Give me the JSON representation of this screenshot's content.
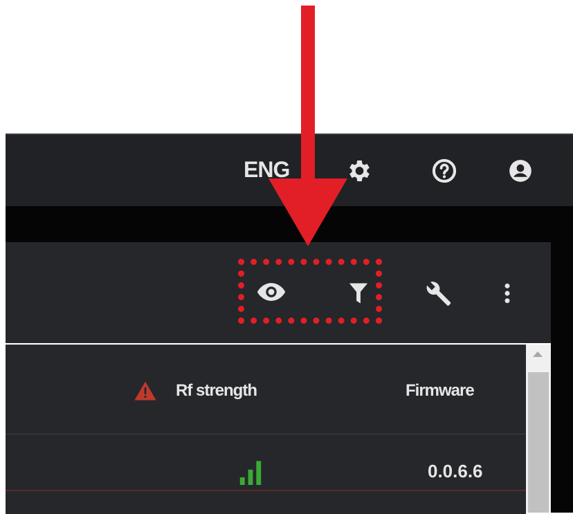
{
  "topbar": {
    "language": "ENG",
    "icons": [
      "gear-icon",
      "help-icon",
      "account-icon"
    ]
  },
  "toolbar": {
    "icons": [
      "eye-icon",
      "filter-icon",
      "wrench-icon",
      "more-vert-icon"
    ]
  },
  "table": {
    "headers": [
      "Rf strength",
      "Firmware"
    ],
    "rows": [
      {
        "rf_strength": "signal-bars",
        "firmware": "0.0.6.6"
      }
    ]
  },
  "annotation": {
    "color": "#e21f26"
  },
  "colors": {
    "topbar_bg": "#202226",
    "panel_bg": "#25272b",
    "warning": "#c0392b",
    "signal": "#3aa935"
  }
}
